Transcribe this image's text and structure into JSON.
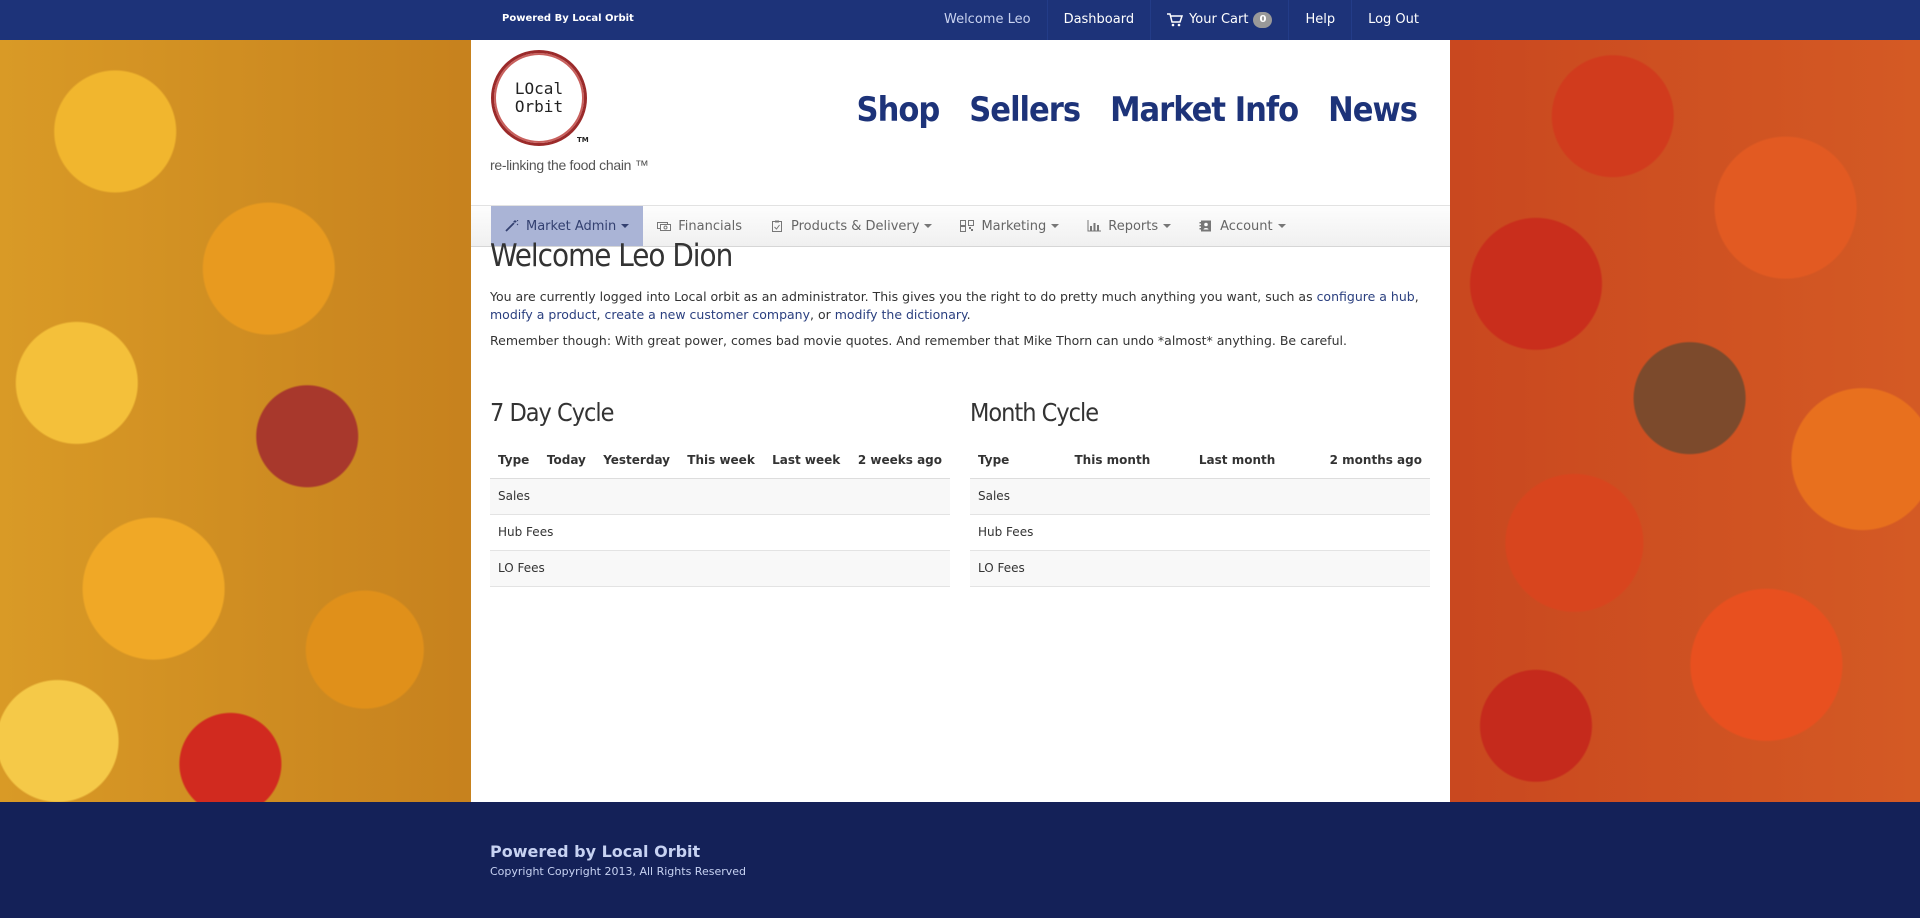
{
  "topbar": {
    "powered": "Powered By Local Orbit",
    "welcome": "Welcome Leo",
    "dashboard": "Dashboard",
    "cart_label": "Your Cart",
    "cart_count": "0",
    "help": "Help",
    "logout": "Log Out"
  },
  "logo": {
    "line1": "LOcal",
    "line2": "Orbit",
    "tm": "TM"
  },
  "tagline": "re-linking the food chain ™",
  "mainnav": [
    "Shop",
    "Sellers",
    "Market Info",
    "News"
  ],
  "adminmenu": [
    {
      "label": "Market Admin",
      "icon": "wand-icon"
    },
    {
      "label": "Financials",
      "icon": "money-icon"
    },
    {
      "label": "Products & Delivery",
      "icon": "clipboard-icon"
    },
    {
      "label": "Marketing",
      "icon": "qrcode-icon"
    },
    {
      "label": "Reports",
      "icon": "barchart-icon"
    },
    {
      "label": "Account",
      "icon": "addressbook-icon"
    }
  ],
  "content": {
    "title": "Welcome Leo Dion",
    "intro_text": "You are currently logged into Local orbit as an administrator. This gives you the right to do pretty much anything you want, such as ",
    "link_hub": "configure a hub",
    "sep1": ", ",
    "link_product": "modify a product",
    "sep2": ", ",
    "link_company": "create a new customer company",
    "sep3": ", or ",
    "link_dictionary": "modify the dictionary",
    "end": ".",
    "remember": "Remember though: With great power, comes bad movie quotes. And remember that Mike Thorn can undo *almost* anything. Be careful."
  },
  "week_table": {
    "title": "7 Day Cycle",
    "headers": [
      "Type",
      "Today",
      "Yesterday",
      "This week",
      "Last week",
      "2 weeks ago"
    ],
    "rows": [
      "Sales",
      "Hub Fees",
      "LO Fees"
    ]
  },
  "month_table": {
    "title": "Month Cycle",
    "headers": [
      "Type",
      "This month",
      "Last month",
      "2 months ago"
    ],
    "rows": [
      "Sales",
      "Hub Fees",
      "LO Fees"
    ]
  },
  "footer": {
    "line1": "Powered by Local Orbit",
    "line2": "Copyright Copyright 2013, All Rights Reserved"
  },
  "colors": {
    "brand_navy": "#1d3379",
    "footer_navy": "#142158",
    "active_menu": "#aab4d6"
  }
}
